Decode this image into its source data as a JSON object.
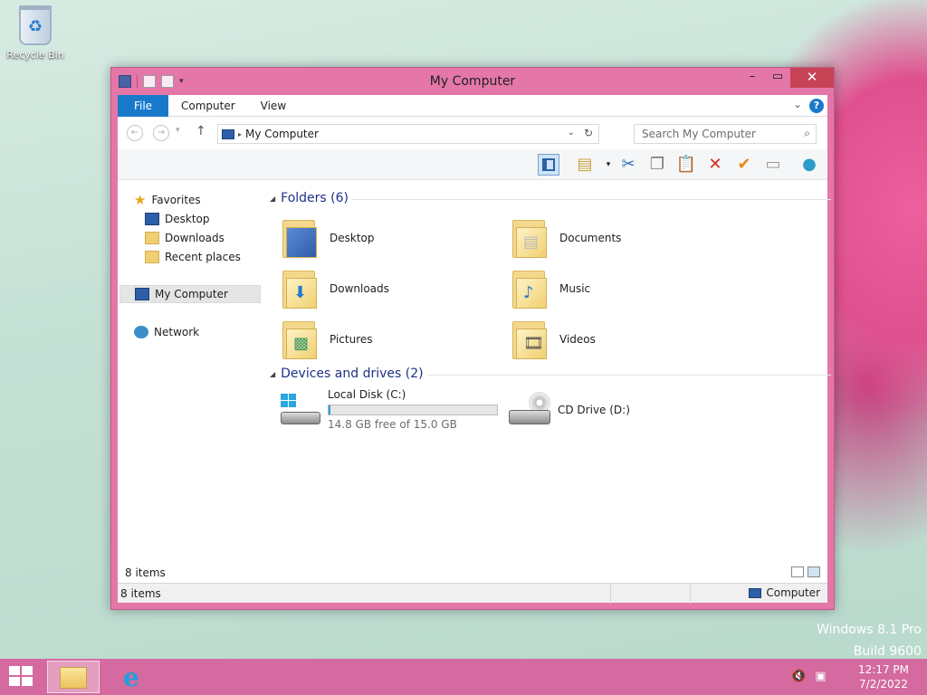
{
  "desktop": {
    "recycle_label": "Recycle Bin",
    "watermark_line1": "Windows 8.1 Pro",
    "watermark_line2": "Build 9600"
  },
  "window": {
    "title": "My Computer"
  },
  "ribbon": {
    "file": "File",
    "tabs": [
      "Computer",
      "View"
    ],
    "help": "?"
  },
  "address": {
    "path": "My Computer",
    "search_placeholder": "Search My Computer"
  },
  "nav": {
    "favorites": "Favorites",
    "items": [
      "Desktop",
      "Downloads",
      "Recent places"
    ],
    "computer": "My Computer",
    "network": "Network"
  },
  "groups": {
    "folders_header": "Folders (6)",
    "folders": [
      "Desktop",
      "Documents",
      "Downloads",
      "Music",
      "Pictures",
      "Videos"
    ],
    "drives_header": "Devices and drives (2)",
    "drive_c_name": "Local Disk (C:)",
    "drive_c_space": "14.8 GB free of 15.0 GB",
    "drive_c_used_fraction": 0.013,
    "drive_d_name": "CD Drive (D:)"
  },
  "status": {
    "items_inner": "8 items",
    "items": "8 items",
    "location": "Computer"
  },
  "taskbar": {
    "time": "12:17 PM",
    "date": "7/2/2022"
  },
  "colors": {
    "accent": "#1979ca",
    "window_frame": "#e576a8",
    "taskbar": "#d46a9f",
    "close": "#c74356"
  }
}
